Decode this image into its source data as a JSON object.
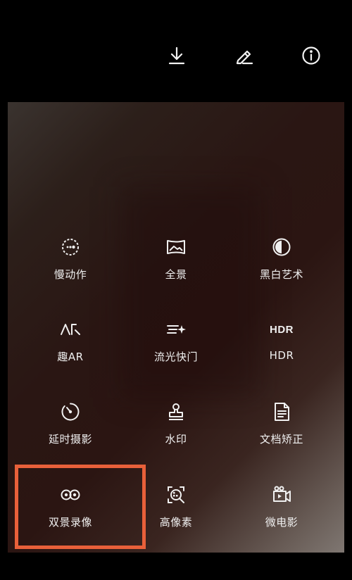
{
  "toolbar": {
    "download_icon": "download-icon",
    "edit_icon": "pencil-icon",
    "info_icon": "info-icon"
  },
  "modes": [
    {
      "label": "慢动作",
      "icon": "slow-motion-icon"
    },
    {
      "label": "全景",
      "icon": "panorama-icon"
    },
    {
      "label": "黑白艺术",
      "icon": "monochrome-icon"
    },
    {
      "label": "趣AR",
      "icon": "ar-icon"
    },
    {
      "label": "流光快门",
      "icon": "light-painting-icon"
    },
    {
      "label": "HDR",
      "icon": "hdr-icon",
      "icon_text": "HDR"
    },
    {
      "label": "延时摄影",
      "icon": "time-lapse-icon"
    },
    {
      "label": "水印",
      "icon": "watermark-stamp-icon"
    },
    {
      "label": "文档矫正",
      "icon": "document-icon"
    },
    {
      "label": "双景录像",
      "icon": "dual-view-icon"
    },
    {
      "label": "高像素",
      "icon": "high-resolution-icon"
    },
    {
      "label": "微电影",
      "icon": "micro-movie-icon"
    }
  ],
  "colors": {
    "highlight": "#e8603a",
    "text": "#f0f0f0",
    "background": "#000000"
  }
}
